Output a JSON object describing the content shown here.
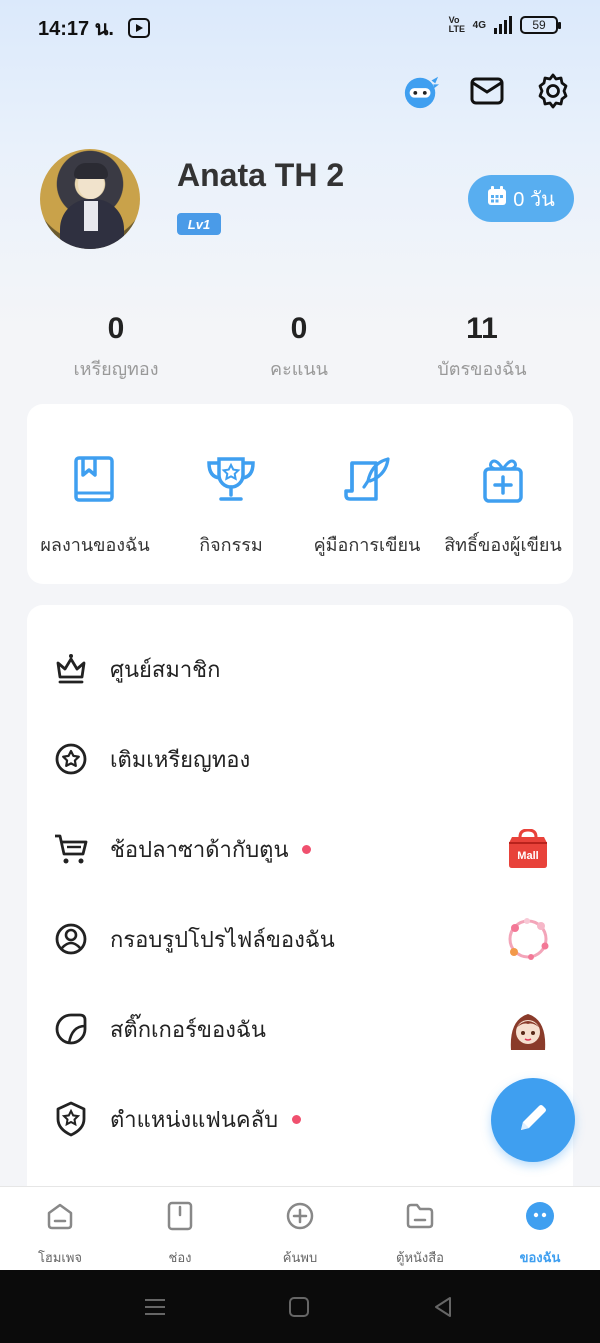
{
  "status_bar": {
    "time": "14:17 น.",
    "network": "4G",
    "volte": "Vo LTE",
    "battery": "59"
  },
  "header": {
    "icons": [
      "ninja-mascot-icon",
      "mail-icon",
      "settings-gear-icon"
    ]
  },
  "profile": {
    "username": "Anata TH 2",
    "level": "Lv1",
    "days_label": "0 วัน"
  },
  "stats": [
    {
      "value": "0",
      "label": "เหรียญทอง"
    },
    {
      "value": "0",
      "label": "คะแนน"
    },
    {
      "value": "11",
      "label": "บัตรของฉัน"
    }
  ],
  "quick_actions": [
    {
      "label": "ผลงานของฉัน",
      "icon": "book-icon"
    },
    {
      "label": "กิจกรรม",
      "icon": "trophy-icon"
    },
    {
      "label": "คู่มือการเขียน",
      "icon": "feather-scroll-icon"
    },
    {
      "label": "สิทธิ์ของผู้เขียน",
      "icon": "gift-icon"
    }
  ],
  "menu": [
    {
      "label": "ศูนย์สมาชิก",
      "icon": "crown-icon",
      "dot": false
    },
    {
      "label": "เติมเหรียญทอง",
      "icon": "coin-star-icon",
      "dot": false
    },
    {
      "label": "ช้อปลาซาด้ากับตูน",
      "icon": "cart-icon",
      "dot": true,
      "thumb_text": "Mall"
    },
    {
      "label": "กรอบรูปโปรไฟล์ของฉัน",
      "icon": "profile-frame-icon",
      "dot": false
    },
    {
      "label": "สติ๊กเกอร์ของฉัน",
      "icon": "sticker-icon",
      "dot": false
    },
    {
      "label": "ตำแหน่งแฟนคลับ",
      "icon": "fan-badge-icon",
      "dot": true
    }
  ],
  "bottom_nav": [
    {
      "label": "โฮมเพจ",
      "icon": "home-icon",
      "active": false
    },
    {
      "label": "ช่อง",
      "icon": "channel-icon",
      "active": false
    },
    {
      "label": "ค้นพบ",
      "icon": "discover-plus-icon",
      "active": false
    },
    {
      "label": "ตู้หนังสือ",
      "icon": "bookshelf-folder-icon",
      "active": false
    },
    {
      "label": "ของฉัน",
      "icon": "my-profile-icon",
      "active": true
    }
  ],
  "colors": {
    "accent": "#3f9ff0",
    "badge": "#4a9be8",
    "dot": "#f0506e",
    "background": "#f4f5f8"
  }
}
